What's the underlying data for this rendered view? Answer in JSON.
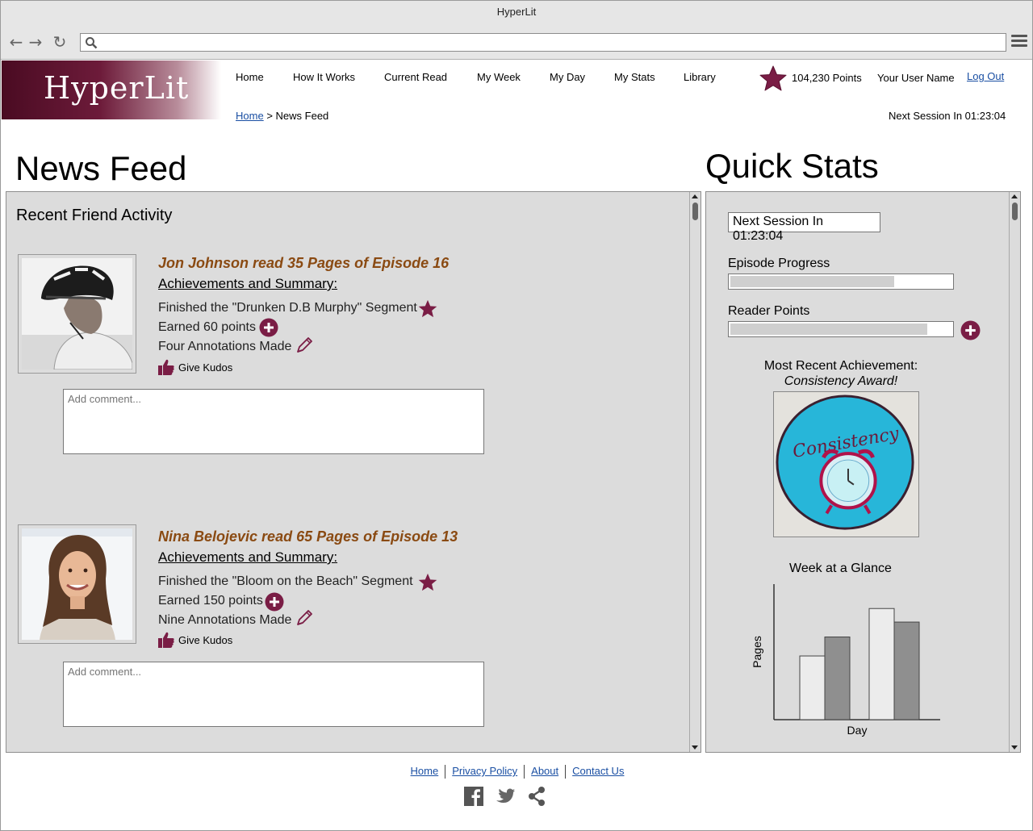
{
  "window": {
    "title": "HyperLit"
  },
  "browser": {
    "url": ""
  },
  "site": {
    "logo": "HyperLit"
  },
  "nav": [
    "Home",
    "How It Works",
    "Current Read",
    "My Week",
    "My Day",
    "My Stats",
    "Library"
  ],
  "header": {
    "points": "104,230 Points",
    "user_name": "Your User Name",
    "logout": "Log Out",
    "next_session": "Next Session In 01:23:04"
  },
  "breadcrumb": {
    "home": "Home",
    "separator": ">",
    "current": "News Feed"
  },
  "news_feed": {
    "title": "News Feed",
    "heading": "Recent Friend Activity",
    "entries": [
      {
        "title": "Jon Johnson read 35 Pages of Episode 16",
        "subtitle": "Achievements and Summary:",
        "segment": "Finished the \"Drunken D.B Murphy\" Segment",
        "points": "Earned 60 points",
        "annotations": "Four Annotations Made",
        "kudos": "Give Kudos",
        "comment_placeholder": "Add comment..."
      },
      {
        "title": "Nina Belojevic read 65 Pages of Episode 13",
        "subtitle": "Achievements and Summary:",
        "segment": "Finished the \"Bloom on the Beach\" Segment",
        "points": "Earned 150 points",
        "annotations": "Nine Annotations Made",
        "kudos": "Give Kudos",
        "comment_placeholder": "Add comment..."
      }
    ]
  },
  "quick_stats": {
    "title": "Quick Stats",
    "next_session": "Next Session In 01:23:04",
    "episode_progress_label": "Episode Progress",
    "episode_progress": 0.74,
    "reader_points_label": "Reader Points",
    "reader_points_progress": 0.89,
    "achievement_label": "Most Recent Achievement:",
    "achievement_name": "Consistency Award!",
    "badge_text": "Consistency",
    "week_title": "Week at a Glance",
    "chart_data": {
      "type": "bar",
      "xlabel": "Day",
      "ylabel": "Pages",
      "ylim": [
        0,
        1
      ],
      "values": [
        0.47,
        0.61,
        0.82,
        0.72
      ],
      "fills": [
        "#ececec",
        "#8f8f8f",
        "#ececec",
        "#8f8f8f"
      ]
    }
  },
  "footer": {
    "links": [
      "Home",
      "Privacy Policy",
      "About",
      "Contact Us"
    ],
    "social_icons": [
      "facebook-icon",
      "twitter-icon",
      "share-icon"
    ]
  },
  "colors": {
    "brand": "#6d1b3a",
    "accent_text": "#8a4a12",
    "link": "#1a4fa3",
    "panel": "#dcdcdc"
  }
}
